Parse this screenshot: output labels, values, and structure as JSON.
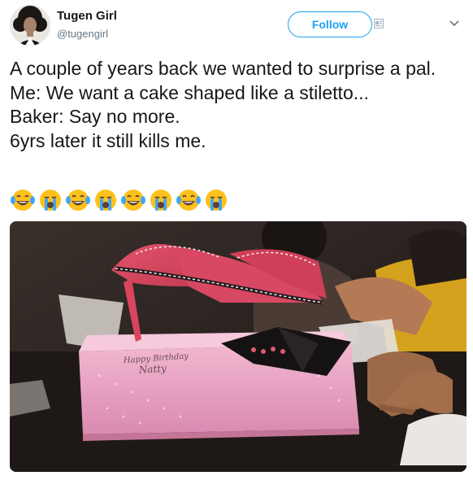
{
  "user": {
    "display_name": "Tugen Girl",
    "handle": "@tugengirl"
  },
  "actions": {
    "follow_label": "Follow"
  },
  "tweet": {
    "text": "A couple of years back we wanted to surprise a pal.\nMe: We want a cake shaped like a stiletto...\nBaker: Say no more.\n6yrs later it still kills me.",
    "emojis": [
      "laughing-crying",
      "loudly-crying",
      "laughing-crying",
      "loudly-crying",
      "laughing-crying",
      "loudly-crying",
      "laughing-crying",
      "loudly-crying"
    ]
  },
  "photo": {
    "cake_inscription_line1": "Happy Birthday",
    "cake_inscription_line2": "Natty"
  },
  "colors": {
    "accent": "#1da1f2",
    "text": "#14171a",
    "secondary_text": "#657786"
  }
}
